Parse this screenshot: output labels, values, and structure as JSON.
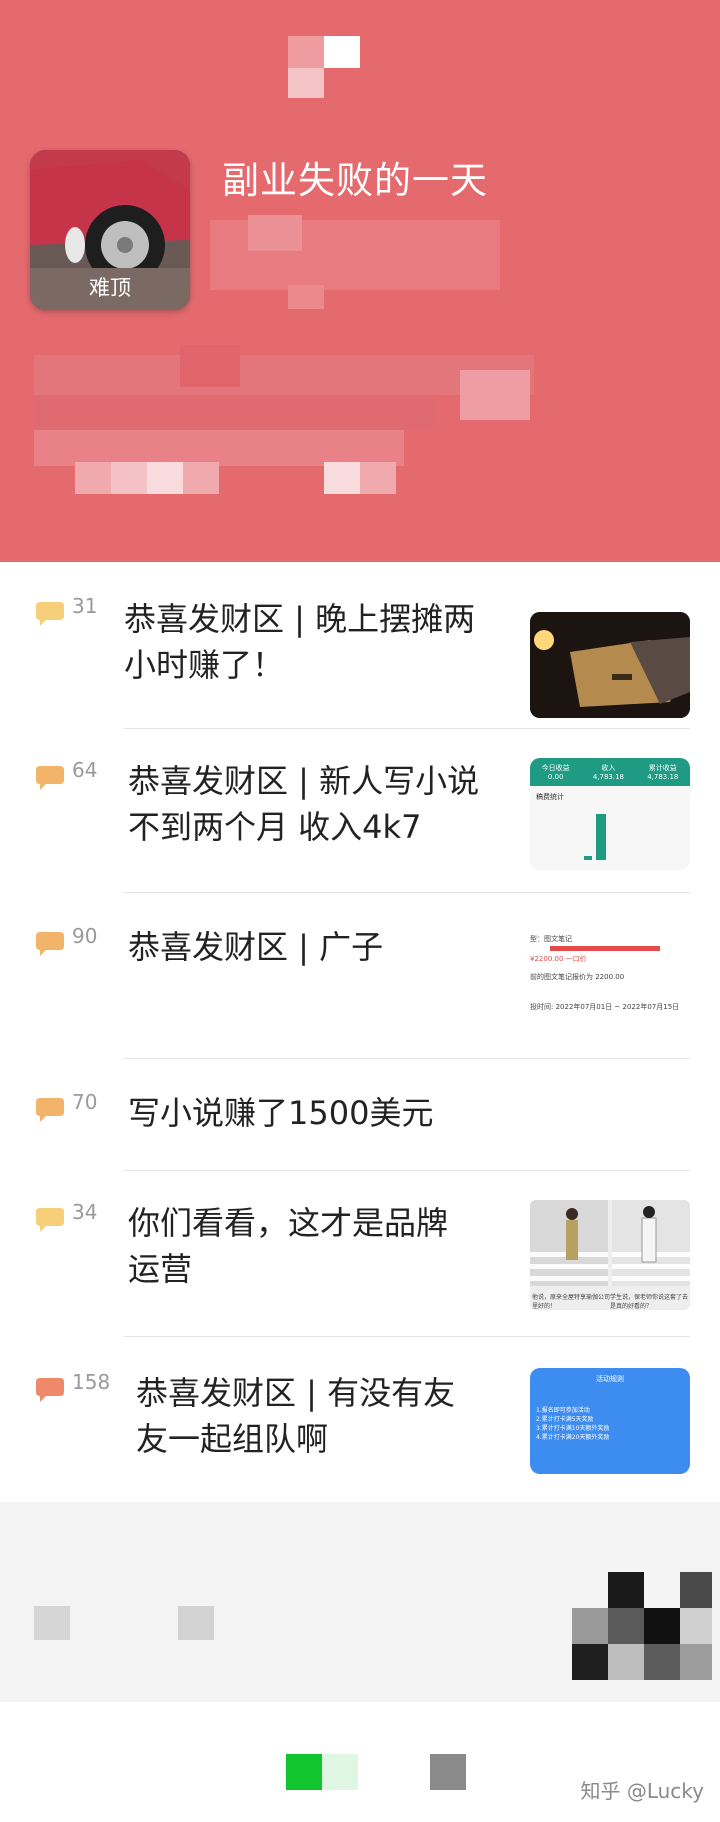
{
  "header": {
    "title": "副业失败的一天",
    "avatar_label": "难顶"
  },
  "threads": [
    {
      "count": "31",
      "title_lines": [
        "恭喜发财区 | 晚上摆摊两",
        "小时赚了！"
      ],
      "bubble_color": "#f5cf7a",
      "has_thumb": true
    },
    {
      "count": "64",
      "title_lines": [
        "恭喜发财区 | 新人写小说",
        "不到两个月 收入4k7"
      ],
      "bubble_color": "#f2b36a",
      "has_thumb": true
    },
    {
      "count": "90",
      "title_lines": [
        "恭喜发财区 | 广子"
      ],
      "bubble_color": "#f2b36a",
      "has_thumb": true
    },
    {
      "count": "70",
      "title_lines": [
        "写小说赚了1500美元"
      ],
      "bubble_color": "#f2b36a",
      "has_thumb": false
    },
    {
      "count": "34",
      "title_lines": [
        "你们看看，这才是品牌",
        "运营"
      ],
      "bubble_color": "#f5cf7a",
      "has_thumb": true
    },
    {
      "count": "158",
      "title_lines": [
        "恭喜发财区 | 有没有友",
        "友一起组队啊"
      ],
      "bubble_color": "#ee8a6a",
      "has_thumb": true
    }
  ],
  "thumbs": {
    "stats_labels": [
      "今日收益",
      "收入",
      "累计收益"
    ],
    "stats_values": [
      "0.00",
      "4,783.18",
      "4,783.18"
    ],
    "stats_sub": "稿费统计",
    "ad_lines": [
      "型：图文笔记",
      "¥2200.00  一口价",
      "前的图文笔记报价为 2200.00",
      "投时间: 2022年07月01日 ~ 2022年07月15日"
    ],
    "fashion_caption_left": "他说，原来全屋特享瑜伽公司里好的！",
    "fashion_caption_right": "学生说，保老师你说这套了去是真的好看的？",
    "team_title": "活动规则",
    "team_lines": [
      "1.报名即可参加活动",
      "2.累计打卡满5天奖励",
      "3.累计打卡满10天额外奖励",
      "4.累计打卡满20天额外奖励"
    ]
  },
  "footer": {
    "watermark": "知乎 @Lucky"
  }
}
